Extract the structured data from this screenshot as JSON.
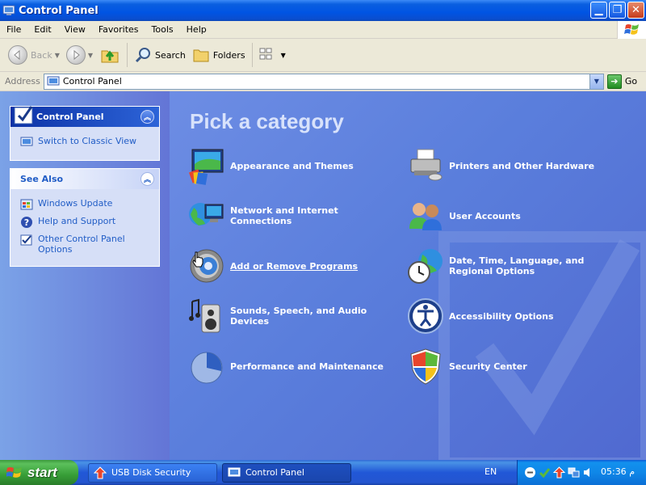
{
  "window": {
    "title": "Control Panel"
  },
  "menu": [
    "File",
    "Edit",
    "View",
    "Favorites",
    "Tools",
    "Help"
  ],
  "toolbar": {
    "back": "Back",
    "search": "Search",
    "folders": "Folders"
  },
  "address": {
    "label": "Address",
    "value": "Control Panel",
    "go": "Go"
  },
  "sidebar": {
    "panel_title": "Control Panel",
    "switch_view": "Switch to Classic View",
    "see_also_title": "See Also",
    "see_also": [
      "Windows Update",
      "Help and Support",
      "Other Control Panel Options"
    ]
  },
  "main": {
    "heading": "Pick a category",
    "categories": [
      "Appearance and Themes",
      "Printers and Other Hardware",
      "Network and Internet Connections",
      "User Accounts",
      "Add or Remove Programs",
      "Date, Time, Language, and Regional Options",
      "Sounds, Speech, and Audio Devices",
      "Accessibility Options",
      "Performance and Maintenance",
      "Security Center"
    ]
  },
  "taskbar": {
    "start": "start",
    "tasks": [
      "USB Disk Security",
      "Control Panel"
    ],
    "language": "EN",
    "clock": "05:36 م"
  },
  "colors": {
    "titlebar": "#0054e3",
    "link": "#215dc6",
    "main_bg": "#5a7edc",
    "start_green": "#379e37"
  }
}
